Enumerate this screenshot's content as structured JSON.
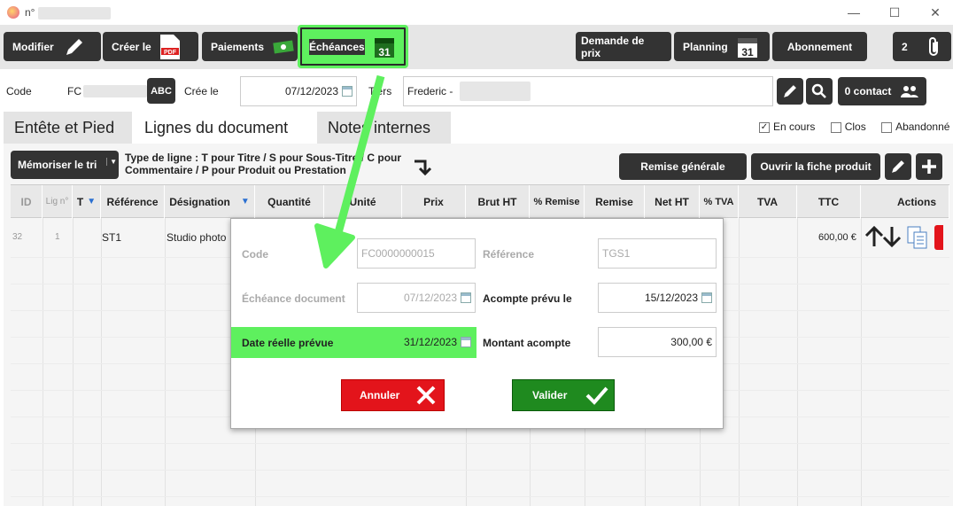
{
  "window": {
    "title_prefix": "n°",
    "minimize": "—",
    "maximize": "☐",
    "close": "✕"
  },
  "toolbar": {
    "modifier": "Modifier",
    "creer_le": "Créer le",
    "paiements": "Paiements",
    "echeances": "Échéances",
    "demande_prix": "Demande de prix",
    "planning": "Planning",
    "abonnement": "Abonnement",
    "attachments_count": "2",
    "calendar_day": "31",
    "pdf_label": "PDF"
  },
  "header": {
    "code_label": "Code",
    "code_value": "FC",
    "abc": "ABC",
    "cree_le_label": "Crée le",
    "cree_le_value": "07/12/2023",
    "tiers_label": "Tiers",
    "tiers_value": "Frederic -",
    "contact_button": "0 contact"
  },
  "tabs": [
    "Entête et Pied",
    "Lignes du document",
    "Notes internes"
  ],
  "status": {
    "en_cours": "En cours",
    "clos": "Clos",
    "abandonne": "Abandonné"
  },
  "lines_toolbar": {
    "memoriser": "Mémoriser le tri",
    "type_info_1": "Type de ligne : T pour Titre / S pour Sous-Titre / C pour",
    "type_info_2": "Commentaire /  P pour Produit ou Prestation",
    "remise_generale": "Remise générale",
    "ouvrir_fiche": "Ouvrir la fiche produit"
  },
  "columns": [
    "ID",
    "Lig n°",
    "T",
    "Référence",
    "Désignation",
    "Quantité",
    "Unité",
    "Prix",
    "Brut HT",
    "% Remise",
    "Remise",
    "Net HT",
    "% TVA",
    "TVA",
    "TTC",
    "Actions"
  ],
  "row": {
    "id": "32",
    "lig": "1",
    "reference": "ST1",
    "designation": "Studio photo",
    "ttc": "600,00 €"
  },
  "modal": {
    "code_label": "Code",
    "code_value": "FC0000000015",
    "reference_label": "Référence",
    "reference_value": "TGS1",
    "echeance_label": "Échéance document",
    "echeance_value": "07/12/2023",
    "acompte_label": "Acompte prévu le",
    "acompte_value": "15/12/2023",
    "date_reelle_label": "Date réelle prévue",
    "date_reelle_value": "31/12/2023",
    "montant_label": "Montant acompte",
    "montant_value": "300,00 €",
    "annuler": "Annuler",
    "valider": "Valider"
  },
  "colors": {
    "accent_green": "#5ef05e",
    "annuler_red": "#e3141b",
    "valider_green": "#1f8a1f",
    "button_dark": "#333333"
  }
}
